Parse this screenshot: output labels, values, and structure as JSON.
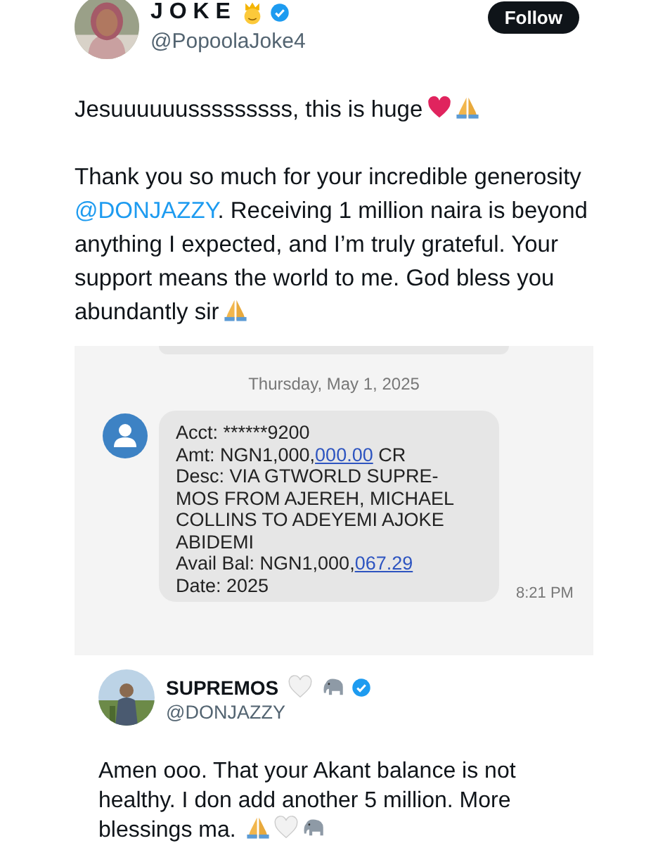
{
  "author": {
    "name": "J O K E",
    "handle": "@PopoolaJoke4",
    "verified": true
  },
  "follow_button": "Follow",
  "post": [
    {
      "text": "Jesuuuuuusssssssss, this is huge"
    },
    {
      "text": "Thank you so much for your incredible generosity ",
      "mention": "@DONJAZZY",
      "after": ".  Receiving 1 million naira is beyond anything I expected, and I’m truly grateful. Your support means the world to me. God bless you",
      "last_line": "abundantly sir"
    }
  ],
  "sms": {
    "date": "Thursday, May 1, 2025",
    "time": "8:21 PM",
    "lines": [
      {
        "text": "Acct: ******9200"
      },
      {
        "text": "Amt: NGN1,000,",
        "link": "000.00",
        "after": " CR"
      },
      {
        "text": "Desc: VIA GTWORLD SUPRE-"
      },
      {
        "text": "MOS FROM AJEREH, MICHAEL"
      },
      {
        "text": "COLLINS TO ADEYEMI AJOKE"
      },
      {
        "text": "ABIDEMI"
      },
      {
        "text": "Avail Bal: NGN1,000,",
        "link": "067.29"
      },
      {
        "text": "Date: 2025"
      }
    ]
  },
  "reply": {
    "name": "SUPREMOS",
    "handle": "@DONJAZZY",
    "verified": true,
    "text": "Amen ooo. That your Akant balance is not healthy. I don add another 5 million. More",
    "last_line": "blessings ma."
  }
}
